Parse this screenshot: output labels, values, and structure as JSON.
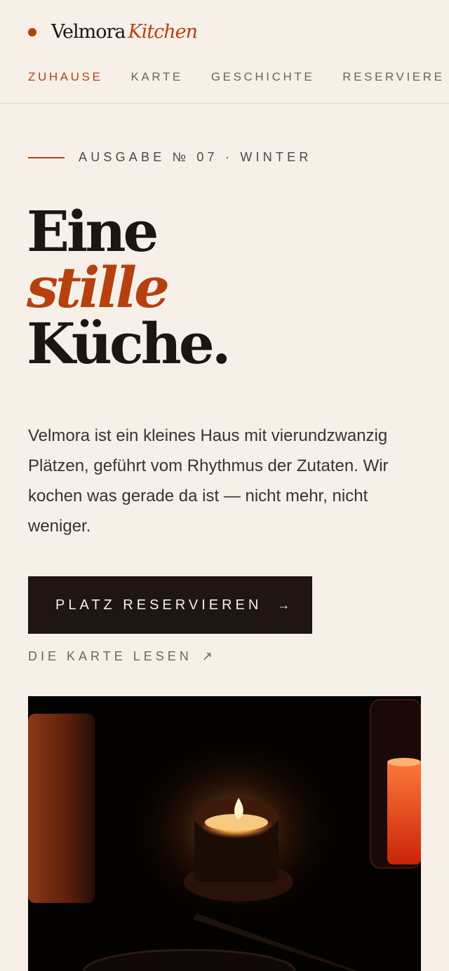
{
  "brand": {
    "name": "Velmora",
    "accent": "Kitchen"
  },
  "nav": [
    {
      "label": "ZUHAUSE",
      "active": true
    },
    {
      "label": "KARTE",
      "active": false
    },
    {
      "label": "GESCHICHTE",
      "active": false
    },
    {
      "label": "RESERVIERE",
      "active": false
    }
  ],
  "hero": {
    "eyebrow": "AUSGABE № 07 · WINTER",
    "headline": [
      "Eine",
      "stille",
      "Küche."
    ],
    "intro": "Velmora ist ein kleines Haus mit vierundzwanzig Plätzen, geführt vom Rhythmus der Zutaten. Wir kochen was gerade da ist — nicht mehr, nicht weniger.",
    "cta_label": "PLATZ RESERVIEREN",
    "cta_icon": "arrow-right-icon",
    "secondary_label": "DIE KARTE LESEN",
    "secondary_icon": "arrow-up-right-icon"
  },
  "colors": {
    "background": "#f7f0e8",
    "accent": "#b5410f",
    "ink": "#1c1512",
    "button": "#1f1613"
  }
}
